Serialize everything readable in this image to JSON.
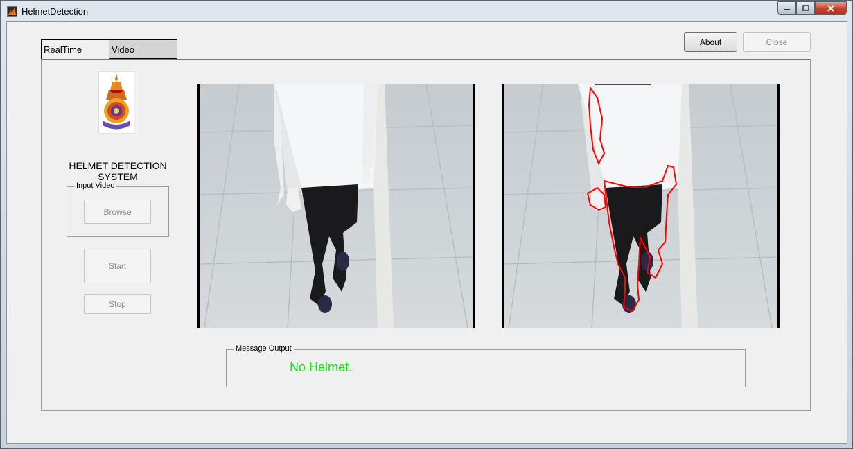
{
  "window": {
    "title": "HelmetDetection",
    "controls": [
      "minimize",
      "maximize",
      "close"
    ]
  },
  "toolbar": {
    "about_label": "About",
    "close_label": "Close"
  },
  "tabs": [
    {
      "label": "RealTime",
      "active": true
    },
    {
      "label": "Video",
      "active": false
    }
  ],
  "left_panel": {
    "logo_icon": "university-seal-logo",
    "system_title": "HELMET DETECTION SYSTEM",
    "input_group_label": "Input Video",
    "browse_label": "Browse",
    "start_label": "Start",
    "stop_label": "Stop"
  },
  "video": {
    "left_frame": "camera-frame-original",
    "right_frame": "camera-frame-detected-contour",
    "contour_color": "#ff0000"
  },
  "message": {
    "group_label": "Message Output",
    "text": "No Helmet.",
    "text_color": "#19e019"
  }
}
